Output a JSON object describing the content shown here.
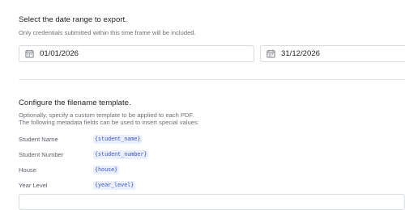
{
  "date_range": {
    "title": "Select the date range to export.",
    "subtitle": "Only credentials submitted within this time frame will be included.",
    "start_value": "01/01/2026",
    "end_value": "31/12/2026"
  },
  "filename_template": {
    "title": "Configure the filename template.",
    "subtitle_line1": "Optionally, specify a custom template to be applied to each PDF.",
    "subtitle_line2": "The following metadata fields can be used to insert special values:",
    "fields": [
      {
        "label": "Student Name",
        "token": "{student_name}"
      },
      {
        "label": "Student Number",
        "token": "{student_number}"
      },
      {
        "label": "House",
        "token": "{house}"
      },
      {
        "label": "Year Level",
        "token": "{year_level}"
      }
    ]
  },
  "colors": {
    "token_text": "#3c55b8",
    "token_bg": "#eaf0ff",
    "border": "#d8dbe0"
  }
}
